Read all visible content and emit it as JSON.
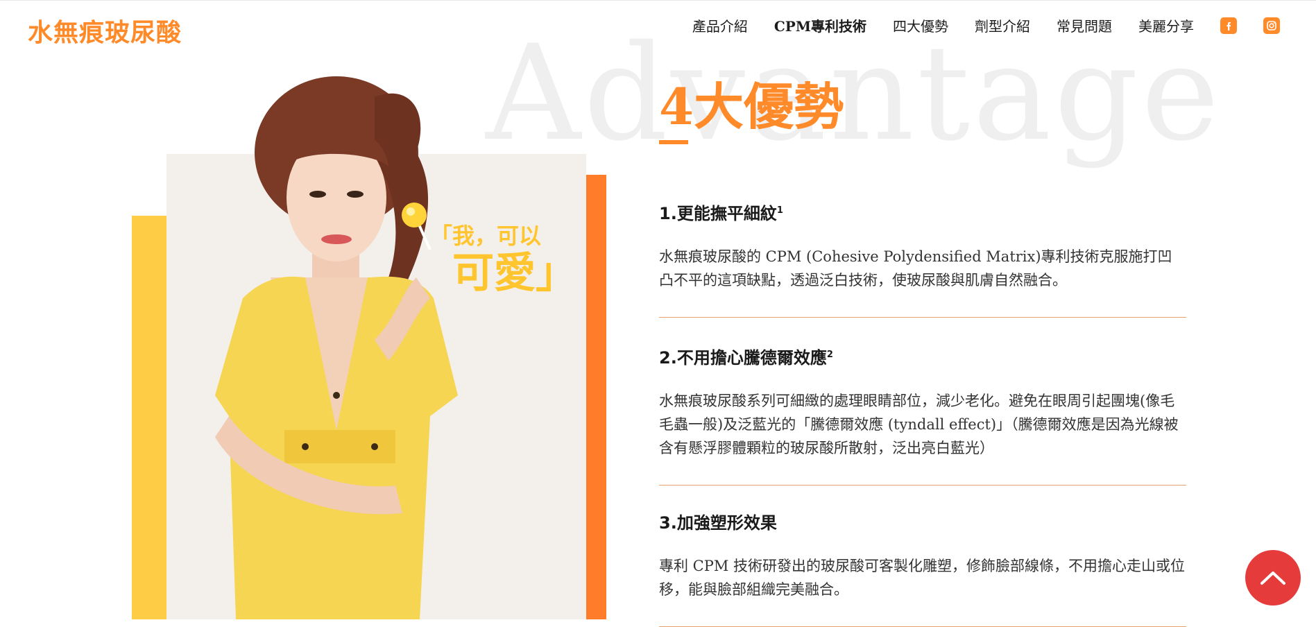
{
  "header": {
    "logo": "水無痕玻尿酸",
    "nav": [
      "產品介紹",
      "CPM專利技術",
      "四大優勢",
      "劑型介紹",
      "常見問題",
      "美麗分享"
    ],
    "social": [
      "facebook-icon",
      "instagram-icon"
    ]
  },
  "section": {
    "watermark": "Advantage",
    "heading": "4大優勢",
    "quote_line1": "「我，可以",
    "quote_line2": "可愛」",
    "advantages": [
      {
        "title": "1.更能撫平細紋",
        "sup": "1",
        "text": "水無痕玻尿酸的 CPM (Cohesive Polydensified Matrix)專利技術克服施打凹凸不平的這項缺點，透過泛白技術，使玻尿酸與肌膚自然融合。"
      },
      {
        "title": "2.不用擔心騰德爾效應",
        "sup": "2",
        "text": "水無痕玻尿酸系列可細緻的處理眼睛部位，減少老化。避免在眼周引起團塊(像毛毛蟲一般)及泛藍光的「騰德爾效應 (tyndall effect)」（騰德爾效應是因為光線被含有懸浮膠體顆粒的玻尿酸所散射，泛出亮白藍光）"
      },
      {
        "title": "3.加強塑形效果",
        "sup": "",
        "text": "專利 CPM 技術研發出的玻尿酸可客製化雕塑，修飾臉部線條，不用擔心走山或位移，能與臉部組織完美融合。"
      }
    ]
  },
  "colors": {
    "brand_orange": "#ff8a2a",
    "yellow": "#ffcd45",
    "back_to_top": "#e53b3b"
  }
}
